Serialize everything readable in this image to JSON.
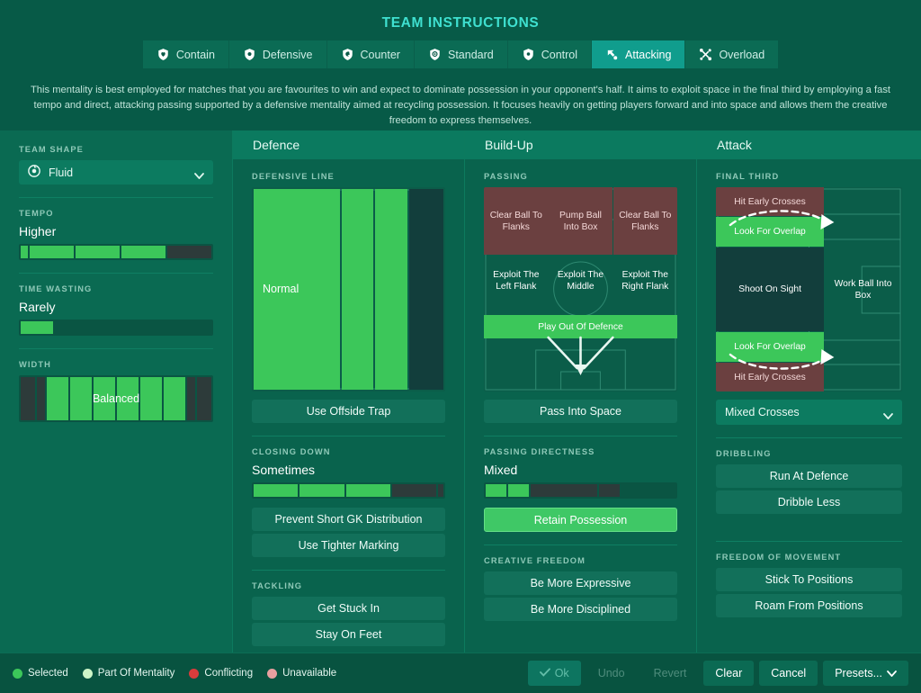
{
  "header": {
    "title": "TEAM INSTRUCTIONS",
    "mentality_tabs": [
      {
        "label": "Contain",
        "icon": "shield-contain-icon",
        "active": false
      },
      {
        "label": "Defensive",
        "icon": "shield-defensive-icon",
        "active": false
      },
      {
        "label": "Counter",
        "icon": "shield-counter-icon",
        "active": false
      },
      {
        "label": "Standard",
        "icon": "shield-standard-icon",
        "active": false
      },
      {
        "label": "Control",
        "icon": "shield-control-icon",
        "active": false
      },
      {
        "label": "Attacking",
        "icon": "arrow-attacking-icon",
        "active": true
      },
      {
        "label": "Overload",
        "icon": "burst-overload-icon",
        "active": false
      }
    ],
    "description": "This mentality is best employed for matches that you are favourites to win and expect to dominate possession in your opponent's half. It aims to exploit space in the final third by employing a fast tempo and direct, attacking passing supported by a defensive mentality aimed at recycling possession. It focuses heavily on getting players forward and into space and allows them the creative freedom to express themselves."
  },
  "sidebar": {
    "team_shape": {
      "label": "TEAM SHAPE",
      "value": "Fluid",
      "icon": "fluid-shape-icon",
      "chevron": "chevron-down-icon"
    },
    "tempo": {
      "label": "TEMPO",
      "value": "Higher",
      "segments": [
        {
          "state": "on",
          "flex": 0.4
        },
        {
          "state": "on",
          "flex": 2.4
        },
        {
          "state": "on",
          "flex": 2.4
        },
        {
          "state": "on",
          "flex": 2.4
        },
        {
          "state": "off",
          "flex": 2.4
        }
      ]
    },
    "time_wasting": {
      "label": "TIME WASTING",
      "value": "Rarely",
      "segments": [
        {
          "state": "on",
          "flex": 1
        },
        {
          "state": "empty",
          "flex": 4.8
        }
      ]
    },
    "width": {
      "label": "WIDTH",
      "value": "Balanced",
      "segments": [
        {
          "state": "off",
          "flex": 1
        },
        {
          "state": "off",
          "flex": 0.55
        },
        {
          "state": "on",
          "flex": 1.5
        },
        {
          "state": "on",
          "flex": 1.5
        },
        {
          "state": "on",
          "flex": 1.5
        },
        {
          "state": "on",
          "flex": 1.5
        },
        {
          "state": "on",
          "flex": 1.5
        },
        {
          "state": "on",
          "flex": 1.5
        },
        {
          "state": "off",
          "flex": 0.55
        },
        {
          "state": "off",
          "flex": 1
        }
      ]
    }
  },
  "defence": {
    "title": "Defence",
    "defensive_line": {
      "label": "DEFENSIVE LINE",
      "value": "Normal",
      "bands": [
        {
          "state": "on",
          "flex": 4.1
        },
        {
          "state": "on",
          "flex": 1.3
        },
        {
          "state": "on",
          "flex": 1.3
        },
        {
          "state": "off",
          "flex": 1.4
        }
      ]
    },
    "offside_trap": "Use Offside Trap",
    "closing_down": {
      "label": "CLOSING DOWN",
      "value": "Sometimes",
      "segments": [
        {
          "state": "on",
          "flex": 1
        },
        {
          "state": "on",
          "flex": 1
        },
        {
          "state": "on",
          "flex": 1
        },
        {
          "state": "off",
          "flex": 1
        },
        {
          "state": "off",
          "flex": 0.12
        }
      ]
    },
    "buttons": [
      "Prevent Short GK Distribution",
      "Use Tighter Marking"
    ],
    "tackling": {
      "label": "TACKLING",
      "buttons": [
        "Get Stuck In",
        "Stay On Feet"
      ]
    }
  },
  "buildup": {
    "title": "Build-Up",
    "passing": {
      "label": "PASSING",
      "zones": [
        {
          "label": "Clear Ball To Flanks",
          "state": "conflicting"
        },
        {
          "label": "Pump Ball Into Box",
          "state": "conflicting"
        },
        {
          "label": "Clear Ball To Flanks",
          "state": "conflicting"
        },
        {
          "label": "Exploit The Left Flank",
          "state": "available"
        },
        {
          "label": "Exploit The Middle",
          "state": "available"
        },
        {
          "label": "Exploit The Right Flank",
          "state": "available"
        },
        {
          "label": "Play Out Of Defence",
          "state": "selected"
        }
      ]
    },
    "pass_into_space": "Pass Into Space",
    "directness": {
      "label": "PASSING DIRECTNESS",
      "value": "Mixed",
      "segments": [
        {
          "state": "on",
          "flex": 1
        },
        {
          "state": "on",
          "flex": 1
        },
        {
          "state": "off",
          "flex": 3.2
        },
        {
          "state": "off",
          "flex": 1
        },
        {
          "state": "empty",
          "flex": 2.6
        }
      ]
    },
    "retain_possession": "Retain Possession",
    "creative_freedom": {
      "label": "CREATIVE FREEDOM",
      "buttons": [
        "Be More Expressive",
        "Be More Disciplined"
      ]
    }
  },
  "attack": {
    "title": "Attack",
    "final_third": {
      "label": "FINAL THIRD",
      "zones": [
        {
          "label": "Hit Early Crosses",
          "state": "conflicting"
        },
        {
          "label": "Look For Overlap",
          "state": "selected"
        },
        {
          "label": "Shoot On Sight",
          "state": "dark"
        },
        {
          "label": "Work Ball Into Box",
          "state": "dark"
        },
        {
          "label": "Look For Overlap",
          "state": "selected"
        },
        {
          "label": "Hit Early Crosses",
          "state": "conflicting"
        }
      ]
    },
    "crosses": {
      "value": "Mixed Crosses",
      "chevron": "chevron-down-icon"
    },
    "dribbling": {
      "label": "DRIBBLING",
      "buttons": [
        "Run At Defence",
        "Dribble Less"
      ]
    },
    "freedom_of_movement": {
      "label": "FREEDOM OF MOVEMENT",
      "buttons": [
        "Stick To Positions",
        "Roam From Positions"
      ]
    }
  },
  "footer": {
    "legend": [
      {
        "label": "Selected",
        "color": "#3cc75a"
      },
      {
        "label": "Part Of Mentality",
        "color": "#cdf5c8"
      },
      {
        "label": "Conflicting",
        "color": "#d83c3c"
      },
      {
        "label": "Unavailable",
        "color": "#e8a0a0"
      }
    ],
    "buttons": [
      {
        "label": "Ok",
        "style": "ok",
        "icon": "check-icon"
      },
      {
        "label": "Undo",
        "style": "dim",
        "icon": ""
      },
      {
        "label": "Revert",
        "style": "dim",
        "icon": ""
      },
      {
        "label": "Clear",
        "style": "normal",
        "icon": ""
      },
      {
        "label": "Cancel",
        "style": "normal",
        "icon": ""
      },
      {
        "label": "Presets...",
        "style": "presets",
        "icon": "chevron-down-icon"
      }
    ]
  },
  "colors": {
    "accent": "#109d8d",
    "selected_green": "#3cc75a",
    "conflicting_red": "#6b4040",
    "panel": "#09634d"
  }
}
